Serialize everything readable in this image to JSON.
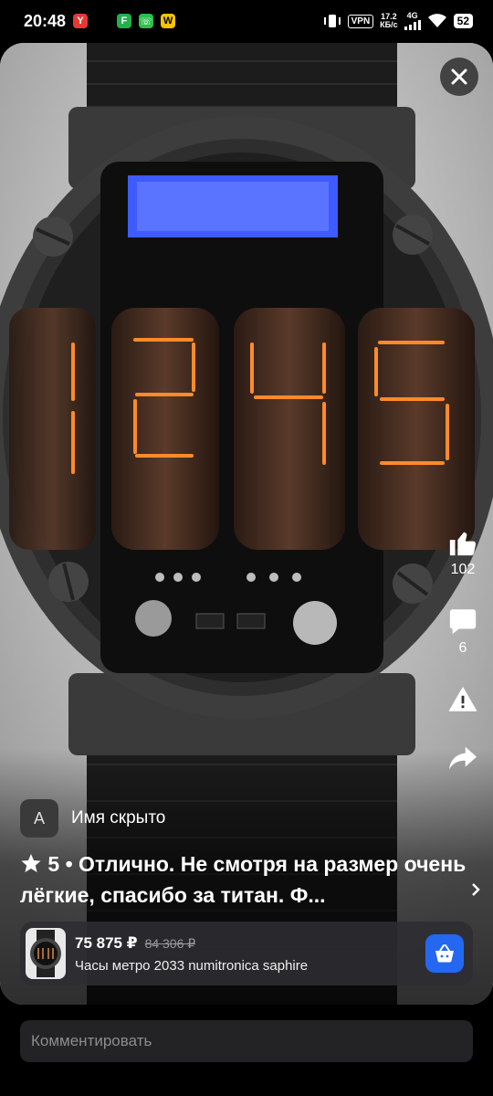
{
  "status_bar": {
    "time": "20:48",
    "vpn": "VPN",
    "speed_value": "17.2",
    "speed_unit": "КБ/с",
    "network": "4G",
    "battery": "52"
  },
  "actions": {
    "likes": "102",
    "comments": "6"
  },
  "author": {
    "initial": "А",
    "name": "Имя скрыто"
  },
  "review": {
    "rating": "5",
    "text": "Отлично. Не смотря на размер очень лёгкие, спасибо за титан. Ф..."
  },
  "product": {
    "price": "75 875 ₽",
    "old_price": "84 306 ₽",
    "name": "Часы метро 2033 numitronica saphire"
  },
  "comment_field": {
    "placeholder": "Комментировать"
  },
  "colors": {
    "accent": "#2468f2",
    "background": "#000000"
  }
}
